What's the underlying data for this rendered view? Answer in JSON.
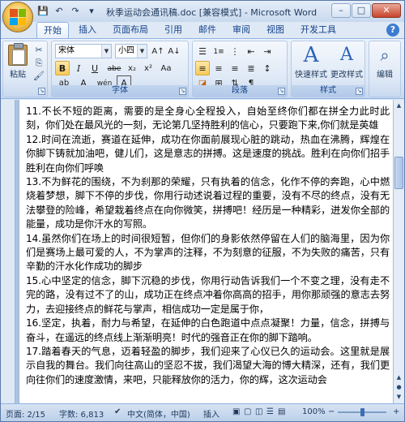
{
  "window": {
    "title": "秋季运动会通讯稿.doc [兼容模式] - Microsoft Word",
    "controls": {
      "minimize": "–",
      "maximize": "□",
      "close": "✕"
    }
  },
  "quick_access": [
    {
      "name": "save",
      "glyph": "💾"
    },
    {
      "name": "undo",
      "glyph": "↶"
    },
    {
      "name": "redo",
      "glyph": "↷"
    },
    {
      "name": "customize",
      "glyph": "▾"
    }
  ],
  "tabs": [
    "开始",
    "插入",
    "页面布局",
    "引用",
    "邮件",
    "审阅",
    "视图",
    "开发工具"
  ],
  "active_tab": "开始",
  "ribbon": {
    "clipboard": {
      "paste_label": "粘贴",
      "group_label": ""
    },
    "font": {
      "font_name": "宋体",
      "font_size": "小四",
      "group_label": "字体",
      "bold": "B",
      "italic": "I",
      "underline": "U",
      "strike": "abe",
      "subscript": "x₂",
      "superscript": "x²",
      "font_color": "A",
      "highlight": "ab",
      "grow": "A↑",
      "shrink": "A↓",
      "clear": "Aa",
      "phonetic": "wén",
      "border_char": "A"
    },
    "paragraph": {
      "group_label": "段落"
    },
    "styles": {
      "quick_styles": "快速样式",
      "change_styles": "更改样式",
      "group_label": "样式"
    },
    "editing": {
      "label": "编辑"
    }
  },
  "document": {
    "paragraphs": [
      "11.不长不短的距离，需要的是全身心全程投入，自始至终你们都在拼全力此时此刻，你们处在最风光的一刻，无论第几坚持胜利的信心，只要跑下来,你们就是英雄",
      "12.时间在流逝，赛道在延伸，成功在你面前展现心脏的跳动，热血在沸腾，辉煌在你脚下铸就加油吧，健儿们，这是意志的拼搏。这是速度的挑战。胜利在向你们招手胜利在向你们呼唤",
      "13.不为鲜花的围绕，不为刹那的荣耀，只有执着的信念，化作不停的奔跑，心中燃烧着梦想，脚下不停的步伐，你用行动述说着过程的重要，没有不尽的终点，没有无法攀登的险峰，希望栽着终点在向你微笑，拼搏吧！经历是一种精彩，迸发你全部的能量，成功是你汗水的写照。",
      "14.虽然你们在场上的时间很短暂，但你们的身影依然停留在人们的脑海里，因为你们是赛场上最可爱的人，不为掌声的注释，不为刻意的征服，不为失败的痛苦，只有辛勤的汗水化作成功的脚步",
      "15.心中坚定的信念，脚下沉稳的步伐，你用行动告诉我们一个不变之理，没有走不完的路，没有过不了的山，成功正在终点冲着你高高的招手，用你那顽强的意志去努力，去迎接终点的鲜花与掌声，相信成功一定是属于你，",
      "16.坚定，执着，耐力与希望，在延伸的白色跑道中点点凝聚！力量，信念，拼搏与奋斗，在遥远的终点线上渐渐明亮！时代的强音正在你的脚下踏响。",
      "17.踏着春天的气息，迈着轻盈的脚步，我们迎来了心仪已久的运动会。这里就是展示自我的舞台。我们向往高山的坚忍不拔，我们渴望大海的博大精深，还有，我们更向往你们的速度激情，来吧，只能释放你的活力，你的辉，这次运动会"
    ]
  },
  "statusbar": {
    "page": "页面: 2/15",
    "words": "字数: 6,813",
    "language": "中文(简体，中国)",
    "mode": "插入",
    "zoom": "100%"
  },
  "zoom_level": 0.5
}
